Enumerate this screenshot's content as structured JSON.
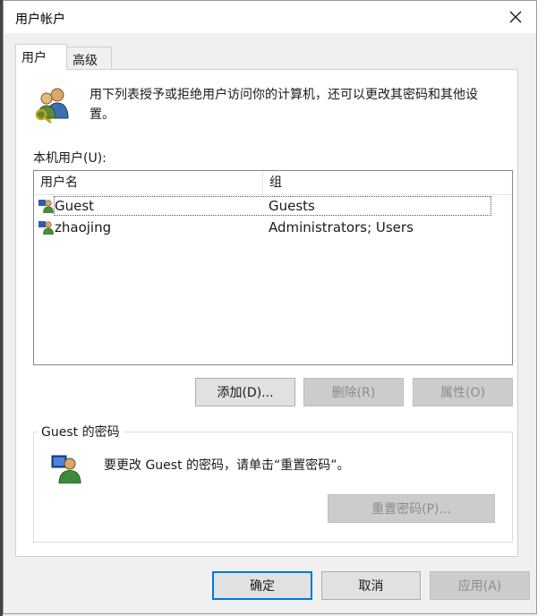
{
  "window": {
    "title": "用户帐户"
  },
  "tabs": [
    {
      "label": "用户",
      "active": true
    },
    {
      "label": "高级",
      "active": false
    }
  ],
  "intro": {
    "icon": "users-keys-icon",
    "text": "用下列表授予或拒绝用户访问你的计算机，还可以更改其密码和其他设置。"
  },
  "users_list": {
    "label": "本机用户(U):",
    "columns": [
      "用户名",
      "组"
    ],
    "rows": [
      {
        "name": "Guest",
        "group": "Guests",
        "selected": true
      },
      {
        "name": "zhaojing",
        "group": "Administrators; Users",
        "selected": false
      }
    ]
  },
  "list_buttons": {
    "add": {
      "label": "添加(D)...",
      "enabled": true
    },
    "remove": {
      "label": "删除(R)",
      "enabled": false
    },
    "properties": {
      "label": "属性(O)",
      "enabled": false
    }
  },
  "password_group": {
    "title": "Guest 的密码",
    "icon": "user-password-icon",
    "text": "要更改 Guest 的密码，请单击“重置密码”。",
    "reset_button": {
      "label": "重置密码(P)...",
      "enabled": false
    }
  },
  "footer_buttons": {
    "ok": {
      "label": "确定",
      "enabled": true
    },
    "cancel": {
      "label": "取消",
      "enabled": true
    },
    "apply": {
      "label": "应用(A)",
      "enabled": false
    }
  },
  "colors": {
    "accent": "#0078d7",
    "disabled_text": "#8c8c8c",
    "disabled_bg": "#cccccc"
  }
}
